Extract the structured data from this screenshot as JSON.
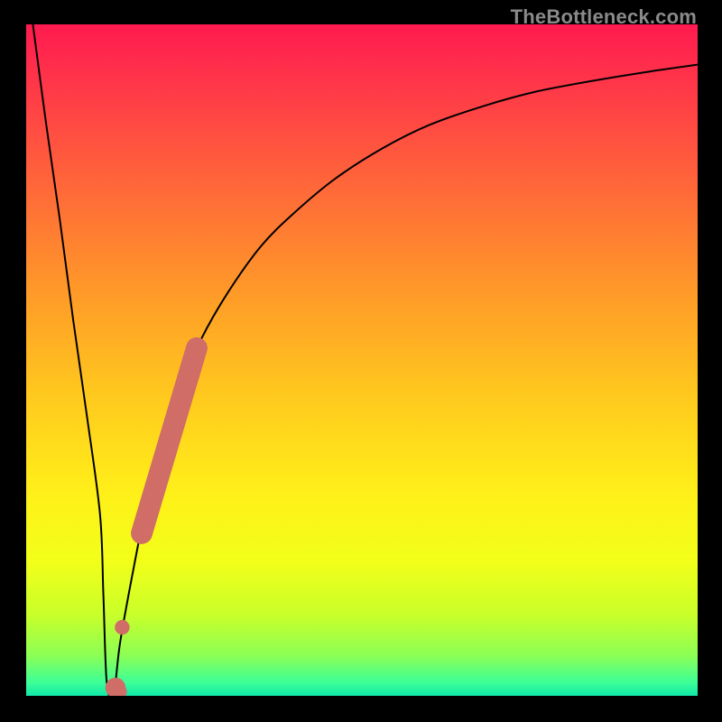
{
  "watermark": "TheBottleneck.com",
  "colors": {
    "curve": "#000000",
    "marker": "#cf6d66",
    "bg_black": "#000000"
  },
  "gradient_stops": [
    {
      "offset": 0.0,
      "color": "#ff1a4f"
    },
    {
      "offset": 0.1,
      "color": "#ff3a48"
    },
    {
      "offset": 0.25,
      "color": "#ff6a38"
    },
    {
      "offset": 0.4,
      "color": "#ff9a28"
    },
    {
      "offset": 0.55,
      "color": "#ffc81e"
    },
    {
      "offset": 0.7,
      "color": "#fff019"
    },
    {
      "offset": 0.8,
      "color": "#f2ff19"
    },
    {
      "offset": 0.88,
      "color": "#c8ff2a"
    },
    {
      "offset": 0.94,
      "color": "#8cff55"
    },
    {
      "offset": 0.98,
      "color": "#3dff97"
    },
    {
      "offset": 1.0,
      "color": "#10e8a8"
    }
  ],
  "chart_data": {
    "type": "line",
    "title": "",
    "xlabel": "",
    "ylabel": "",
    "xlim": [
      0,
      100
    ],
    "ylim": [
      0,
      100
    ],
    "series": [
      {
        "name": "curve",
        "x": [
          1,
          3,
          5,
          7,
          9,
          11,
          11.5,
          12,
          13,
          14,
          16,
          18,
          20,
          23,
          26,
          30,
          35,
          40,
          46,
          53,
          60,
          68,
          76,
          85,
          93,
          100
        ],
        "y": [
          100,
          85,
          71,
          56,
          42,
          27,
          15,
          2,
          0,
          8,
          19,
          29,
          37,
          46,
          53,
          60,
          67,
          72,
          77,
          81.5,
          85,
          87.8,
          90,
          91.7,
          93,
          94
        ]
      }
    ],
    "markers": [
      {
        "shape": "segment",
        "x0": 17.2,
        "y0": 24.2,
        "x1": 25.4,
        "y1": 51.8,
        "width": 3.2
      },
      {
        "shape": "circle",
        "cx": 14.3,
        "cy": 10.2,
        "r": 1.1
      },
      {
        "shape": "circle",
        "cx": 13.3,
        "cy": 1.2,
        "r": 1.5
      },
      {
        "shape": "circle",
        "cx": 13.9,
        "cy": 0.6,
        "r": 1.1
      }
    ]
  }
}
